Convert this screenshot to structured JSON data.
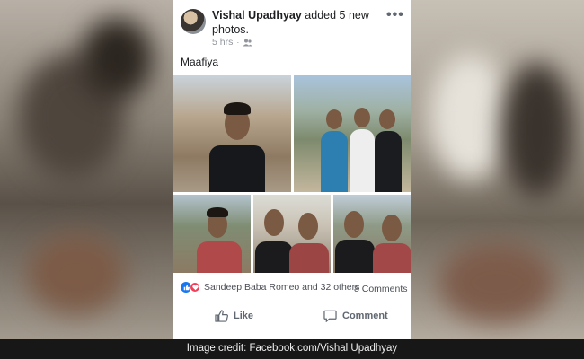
{
  "post": {
    "author": "Vishal Upadhyay",
    "action_text": "added 5 new photos.",
    "time": "5 hrs",
    "privacy_icon": "friends-icon",
    "more_icon": "more-options-icon",
    "caption": "Maafiya",
    "photos_count": 5,
    "reactions": {
      "icons": [
        "like-reaction-icon",
        "love-reaction-icon"
      ],
      "text": "Sandeep Baba Romeo and 32 others"
    },
    "comments_count": "8 Comments",
    "actions": {
      "like_label": "Like",
      "comment_label": "Comment"
    }
  },
  "footer": {
    "credit": "Image credit: Facebook.com/Vishal Upadhyay"
  },
  "colors": {
    "facebook_blue": "#1877f2",
    "love_red": "#f33e58",
    "text_dark": "#1c1e21",
    "text_grey": "#606770"
  }
}
